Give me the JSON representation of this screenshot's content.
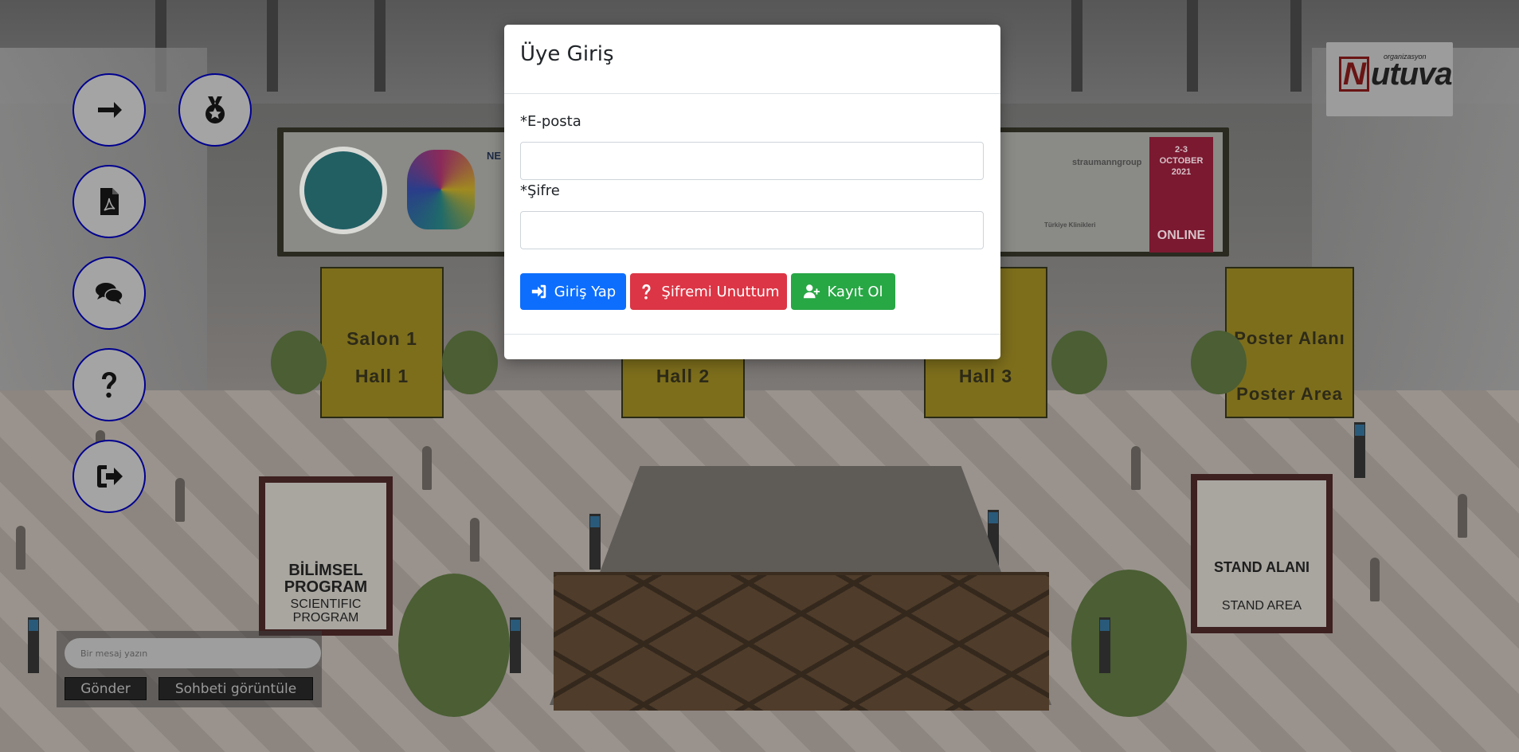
{
  "modal": {
    "title": "Üye Giriş",
    "email_label": "*E-posta",
    "email_value": "",
    "password_label": "*Şifre",
    "password_value": "",
    "login_label": "Giriş Yap",
    "forgot_label": "Şifremi Unuttum",
    "register_label": "Kayıt Ol",
    "colors": {
      "login": "#0d6efd",
      "forgot": "#dc3545",
      "register": "#28a745"
    }
  },
  "sidebar": {
    "buttons": [
      {
        "name": "arrow-right-icon"
      },
      {
        "name": "medal-icon"
      },
      {
        "name": "pdf-file-icon"
      },
      {
        "name": "chat-bubbles-icon"
      },
      {
        "name": "question-icon"
      },
      {
        "name": "sign-out-icon"
      }
    ],
    "border_color": "#00008f"
  },
  "chat": {
    "placeholder": "Bir mesaj yazın",
    "send_label": "Gönder",
    "view_label": "Sohbeti görüntüle"
  },
  "scene": {
    "banner": {
      "date_line1": "2-3",
      "date_line2": "OCTOBER",
      "date_line3": "2021",
      "online": "ONLINE",
      "neu_text": "NE",
      "sponsors": [
        "straumanngroup",
        "Türkiye Klinikleri"
      ]
    },
    "halls": [
      {
        "line1": "Salon 1",
        "line2": "Hall 1"
      },
      {
        "line1": "",
        "line2": "Hall 2"
      },
      {
        "line1": "n 3",
        "line2": "Hall 3"
      },
      {
        "line1": "Poster Alanı",
        "line2": "Poster Area"
      }
    ],
    "sign_left": {
      "title": "BİLİMSEL PROGRAM",
      "subtitle": "SCIENTIFIC PROGRAM"
    },
    "sign_right": {
      "title": "STAND ALANI",
      "subtitle": "STAND AREA"
    },
    "logo": {
      "word": "utuva",
      "letter": "N",
      "small": "organizasyon"
    }
  }
}
